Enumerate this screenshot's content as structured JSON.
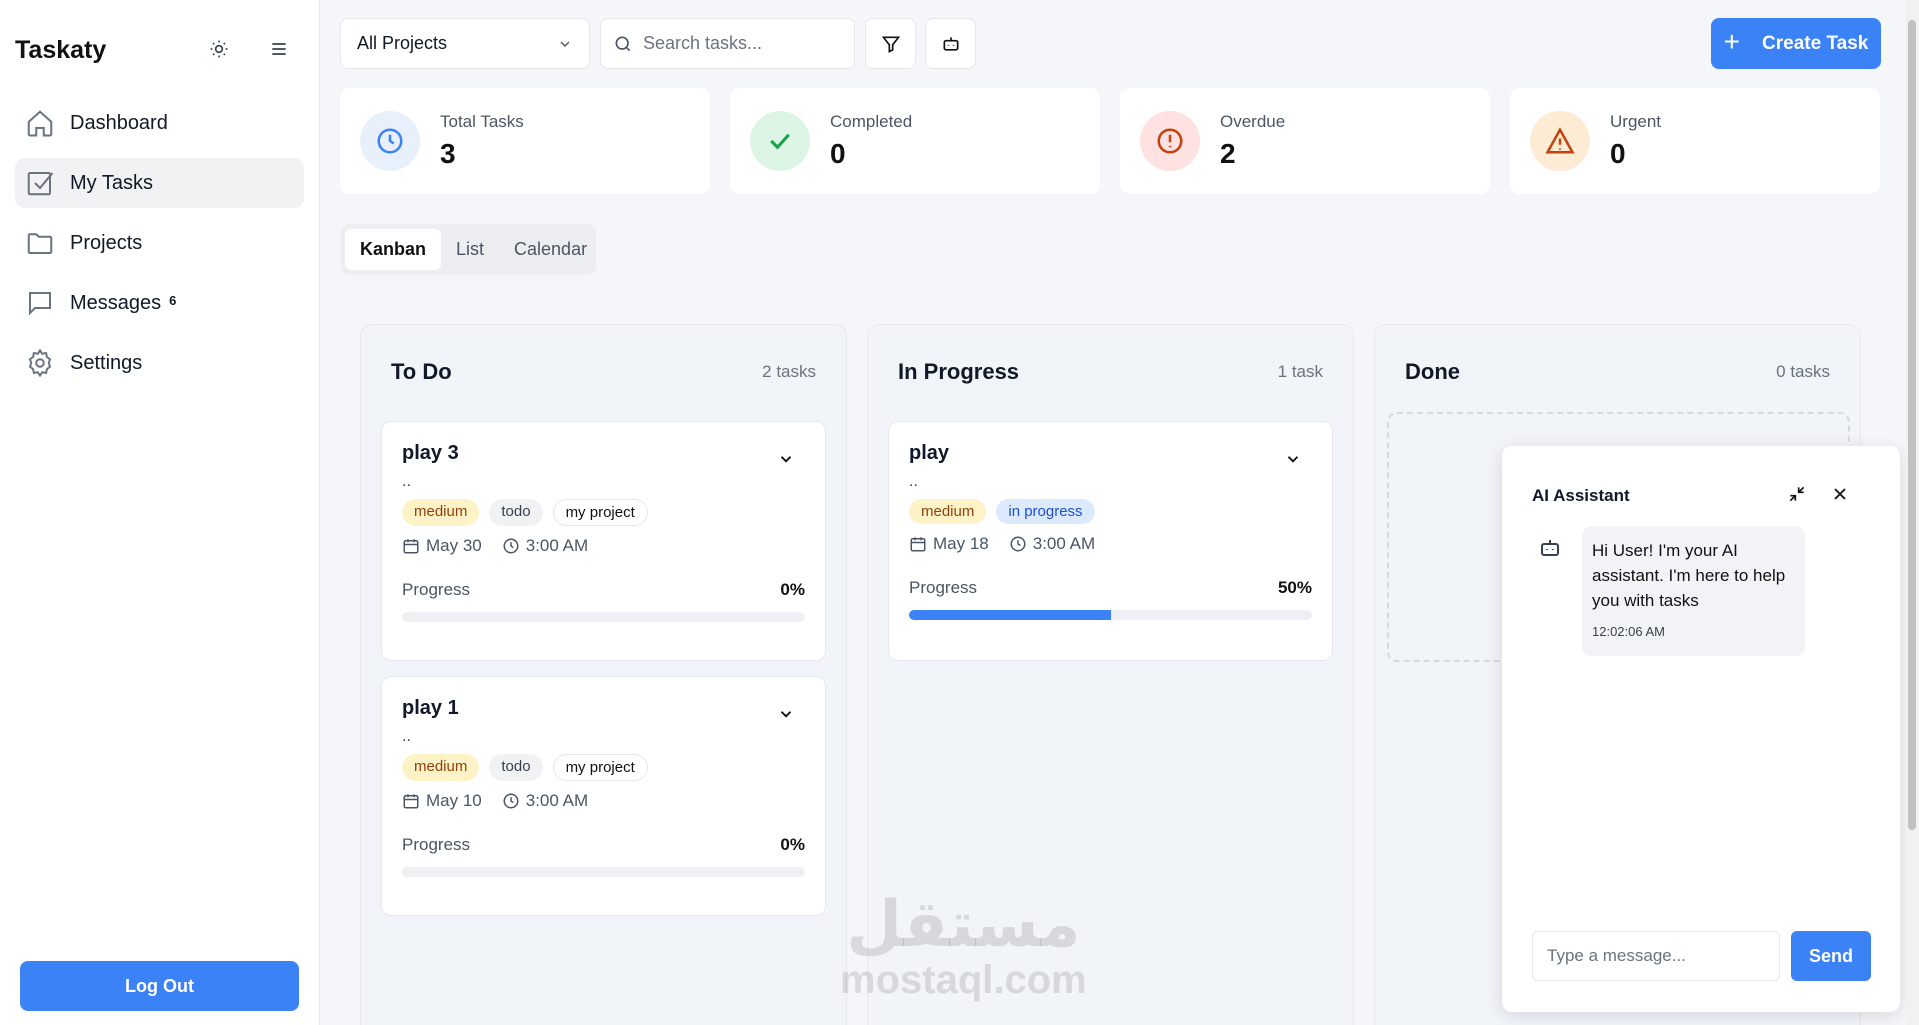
{
  "app": {
    "brand": "Taskaty"
  },
  "sidebar": {
    "items": [
      {
        "label": "Dashboard",
        "icon": "home-icon"
      },
      {
        "label": "My Tasks",
        "icon": "checkbox-icon",
        "active": true
      },
      {
        "label": "Projects",
        "icon": "folder-icon"
      },
      {
        "label": "Messages",
        "icon": "message-icon",
        "badge": "6"
      },
      {
        "label": "Settings",
        "icon": "gear-icon"
      }
    ],
    "logout_label": "Log Out"
  },
  "toolbar": {
    "project_select": "All Projects",
    "search_placeholder": "Search tasks...",
    "create_label": "Create Task"
  },
  "stats": [
    {
      "label": "Total Tasks",
      "value": "3",
      "icon": "clock-icon",
      "color": "#3b82f6",
      "bg": "#e8f0fc"
    },
    {
      "label": "Completed",
      "value": "0",
      "icon": "check-icon",
      "color": "#16a34a",
      "bg": "#dcf5e4"
    },
    {
      "label": "Overdue",
      "value": "2",
      "icon": "alert-circle-icon",
      "color": "#c2410c",
      "bg": "#fde2e1"
    },
    {
      "label": "Urgent",
      "value": "0",
      "icon": "warning-icon",
      "color": "#c2410c",
      "bg": "#fdebd3"
    }
  ],
  "view_tabs": [
    "Kanban",
    "List",
    "Calendar"
  ],
  "columns": [
    {
      "title": "To Do",
      "count": "2 tasks",
      "tasks": [
        {
          "title": "play 3",
          "desc": "..",
          "priority": "medium",
          "status": "todo",
          "project": "my project",
          "date": "May 30",
          "time": "3:00 AM",
          "progress_label": "Progress",
          "progress": "0%",
          "progress_value": 0
        },
        {
          "title": "play 1",
          "desc": "..",
          "priority": "medium",
          "status": "todo",
          "project": "my project",
          "date": "May 10",
          "time": "3:00 AM",
          "progress_label": "Progress",
          "progress": "0%",
          "progress_value": 0
        }
      ]
    },
    {
      "title": "In Progress",
      "count": "1 task",
      "tasks": [
        {
          "title": "play",
          "desc": "..",
          "priority": "medium",
          "status": "in progress",
          "date": "May 18",
          "time": "3:00 AM",
          "progress_label": "Progress",
          "progress": "50%",
          "progress_value": 50
        }
      ]
    },
    {
      "title": "Done",
      "count": "0 tasks",
      "tasks": []
    }
  ],
  "ai": {
    "title": "AI Assistant",
    "message": "Hi User! I'm your AI assistant. I'm here to help you with tasks",
    "time": "12:02:06 AM",
    "input_placeholder": "Type a message...",
    "send_label": "Send"
  },
  "watermark": {
    "arabic": "مستقل",
    "latin": "mostaql.com"
  }
}
